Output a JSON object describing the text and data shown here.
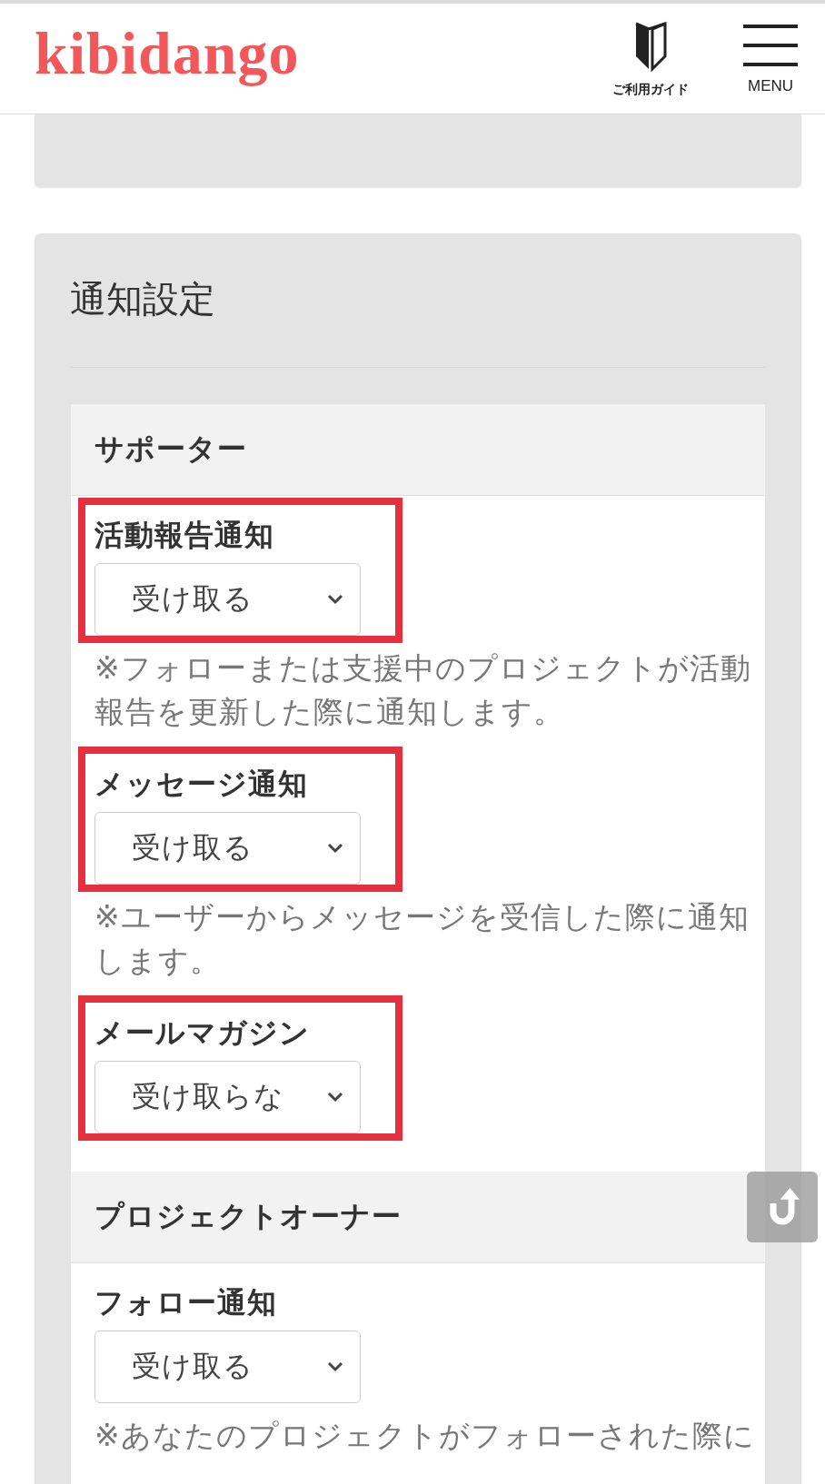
{
  "header": {
    "logo": "kibidango",
    "guide_label": "ご利用ガイド",
    "menu_label": "MENU"
  },
  "settings": {
    "title": "通知設定",
    "sections": [
      {
        "title": "サポーター",
        "items": [
          {
            "label": "活動報告通知",
            "value": "受け取る",
            "note": "※フォローまたは支援中のプロジェクトが活動報告を更新した際に通知します。",
            "highlighted": true
          },
          {
            "label": "メッセージ通知",
            "value": "受け取る",
            "note": "※ユーザーからメッセージを受信した際に通知します。",
            "highlighted": true
          },
          {
            "label": "メールマガジン",
            "value": "受け取らな",
            "highlighted": true
          }
        ]
      },
      {
        "title": "プロジェクトオーナー",
        "items": [
          {
            "label": "フォロー通知",
            "value": "受け取る",
            "note": "※あなたのプロジェクトがフォローされた際に",
            "highlighted": false
          }
        ]
      }
    ]
  }
}
